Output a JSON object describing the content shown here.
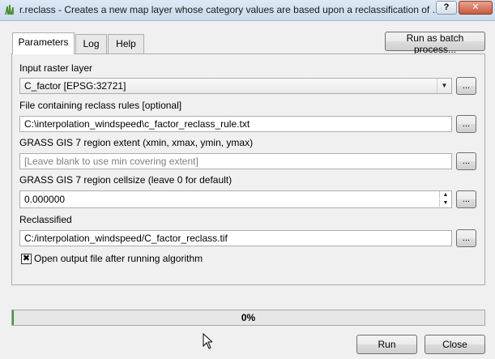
{
  "window": {
    "title": "r.reclass - Creates a new map layer whose category values are based upon a reclassification of ..."
  },
  "tabs": [
    {
      "label": "Parameters",
      "active": true
    },
    {
      "label": "Log",
      "active": false
    },
    {
      "label": "Help",
      "active": false
    }
  ],
  "batch_button_label": "Run as batch process...",
  "form": {
    "input_raster": {
      "label": "Input raster layer",
      "value": "C_factor [EPSG:32721]"
    },
    "rules_file": {
      "label": "File containing reclass rules [optional]",
      "value": "C:\\interpolation_windspeed\\c_factor_reclass_rule.txt"
    },
    "region_extent": {
      "label": "GRASS GIS 7 region extent (xmin, xmax, ymin, ymax)",
      "placeholder": "[Leave blank to use min covering extent]"
    },
    "cellsize": {
      "label": "GRASS GIS 7 region cellsize (leave 0 for default)",
      "value": "0.000000"
    },
    "reclassified": {
      "label": "Reclassified",
      "value": "C:/interpolation_windspeed/C_factor_reclass.tif"
    },
    "browse_label": "...",
    "open_output": {
      "label": "Open output file after running algorithm",
      "checked": true
    }
  },
  "progress": {
    "value": 0,
    "text": "0%"
  },
  "buttons": {
    "run": "Run",
    "close": "Close"
  },
  "icons": {
    "app": "grass-icon",
    "help": "help-icon",
    "close": "close-icon"
  },
  "colors": {
    "accent": "#3c9a3c",
    "titlebar": "#c9d9ec"
  }
}
